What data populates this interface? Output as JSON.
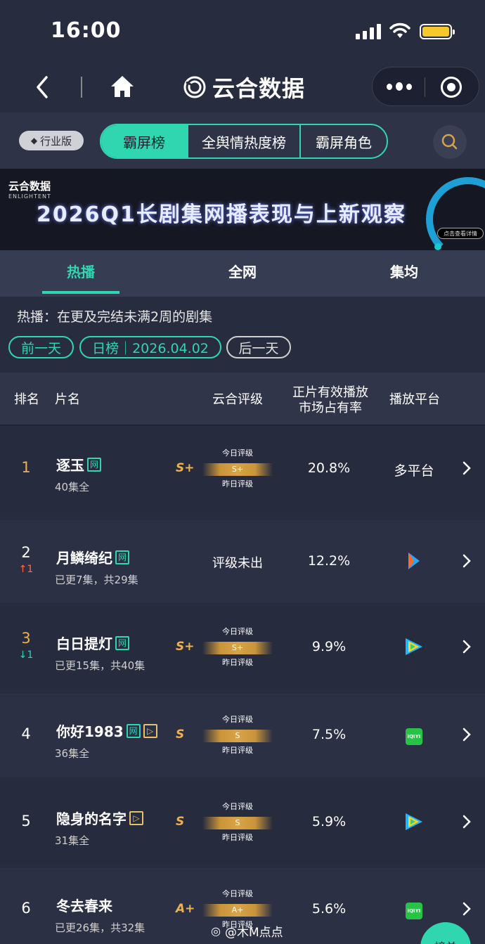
{
  "status_bar": {
    "time": "16:00"
  },
  "nav": {
    "title": "云合数据"
  },
  "filters": {
    "industry_label": "行业版",
    "segments": [
      "霸屏榜",
      "全舆情热度榜",
      "霸屏角色"
    ]
  },
  "banner": {
    "logo_text": "云合数据",
    "logo_sub": "ENLIGHTENT",
    "title": "2026Q1长剧集网播表现与上新观察",
    "button": "点击查看详情"
  },
  "tabs": [
    "热播",
    "全网",
    "集均"
  ],
  "description": "热播：在更及完结未满2周的剧集",
  "date_controls": {
    "prev": "前一天",
    "current": "日榜｜2026.04.02",
    "next": "后一天"
  },
  "table": {
    "headers": {
      "rank": "排名",
      "title": "片名",
      "rating": "云合评级",
      "share_line1": "正片有效播放",
      "share_line2": "市场占有率",
      "platform": "播放平台"
    },
    "gauge_labels": {
      "today": "今日评级",
      "yesterday": "昨日评级"
    },
    "rows": [
      {
        "rank": "1",
        "change": "",
        "title": "逐玉",
        "tags": [
          "网"
        ],
        "sub": "40集全",
        "grade": "S+",
        "gauge": "S+",
        "pending": "",
        "share": "20.8%",
        "platform_text": "多平台",
        "platform_icon": ""
      },
      {
        "rank": "2",
        "change": "↑1",
        "title": "月鳞绮纪",
        "tags": [
          "网"
        ],
        "sub": "已更7集，共29集",
        "grade": "",
        "gauge": "",
        "pending": "评级未出",
        "share": "12.2%",
        "platform_text": "",
        "platform_icon": "youku-icon"
      },
      {
        "rank": "3",
        "change": "↓1",
        "title": "白日提灯",
        "tags": [
          "网"
        ],
        "sub": "已更15集，共40集",
        "grade": "S+",
        "gauge": "S+",
        "pending": "",
        "share": "9.9%",
        "platform_text": "",
        "platform_icon": "tencent-video-icon"
      },
      {
        "rank": "4",
        "change": "",
        "title": "你好1983",
        "tags": [
          "网",
          "play"
        ],
        "sub": "36集全",
        "grade": "S",
        "gauge": "S",
        "pending": "",
        "share": "7.5%",
        "platform_text": "",
        "platform_icon": "iqiyi-icon"
      },
      {
        "rank": "5",
        "change": "",
        "title": "隐身的名字",
        "tags": [
          "play"
        ],
        "sub": "31集全",
        "grade": "S",
        "gauge": "S",
        "pending": "",
        "share": "5.9%",
        "platform_text": "",
        "platform_icon": "tencent-video-icon"
      },
      {
        "rank": "6",
        "change": "",
        "title": "冬去春来",
        "tags": [],
        "sub": "已更26集，共32集",
        "grade": "A+",
        "gauge": "A+",
        "pending": "",
        "share": "5.6%",
        "platform_text": "",
        "platform_icon": "iqiyi-icon"
      }
    ]
  },
  "watermark": "@木M点点",
  "float_button": "榜单",
  "colors": {
    "accent": "#30d6b0",
    "background": "#272c3f",
    "grade": "#f0b14c"
  }
}
